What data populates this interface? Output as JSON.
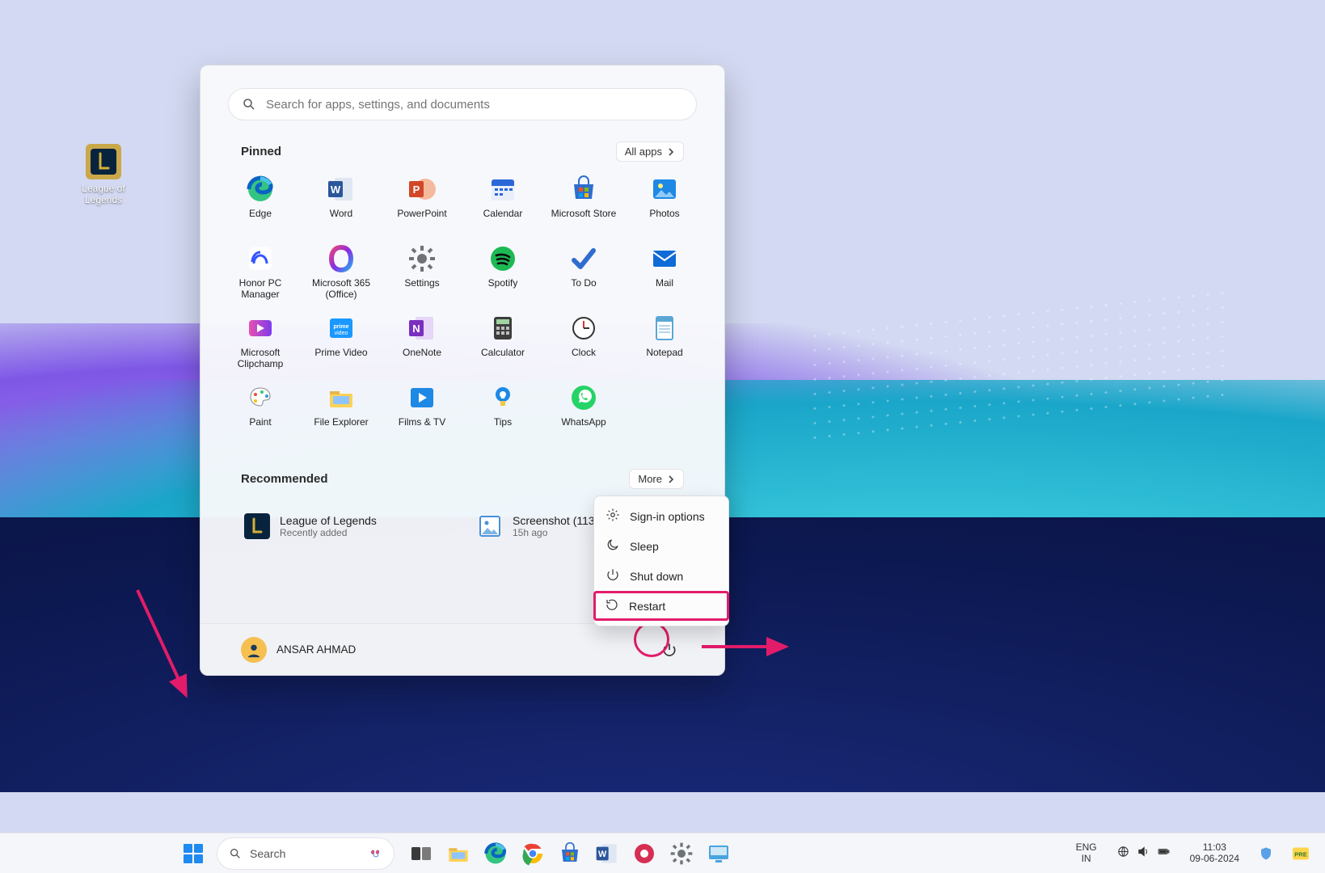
{
  "desktop": {
    "icons": [
      {
        "label": "League of Legends"
      }
    ]
  },
  "start_menu": {
    "search_placeholder": "Search for apps, settings, and documents",
    "pinned_heading": "Pinned",
    "all_apps_label": "All apps",
    "pinned": [
      {
        "label": "Edge",
        "color": "#26a5d6",
        "icon": "edge"
      },
      {
        "label": "Word",
        "color": "#2b579a",
        "icon": "word"
      },
      {
        "label": "PowerPoint",
        "color": "#d24726",
        "icon": "powerpoint"
      },
      {
        "label": "Calendar",
        "color": "#2b67d6",
        "icon": "calendar"
      },
      {
        "label": "Microsoft Store",
        "color": "#2f6dd0",
        "icon": "store"
      },
      {
        "label": "Photos",
        "color": "#1e88e5",
        "icon": "photos"
      },
      {
        "label": "Honor PC Manager",
        "color": "#3455ff",
        "icon": "honorpc"
      },
      {
        "label": "Microsoft 365 (Office)",
        "color": "#8a2be2",
        "icon": "m365"
      },
      {
        "label": "Settings",
        "color": "#6f7276",
        "icon": "settings"
      },
      {
        "label": "Spotify",
        "color": "#1db954",
        "icon": "spotify"
      },
      {
        "label": "To Do",
        "color": "#2f6dd0",
        "icon": "todo"
      },
      {
        "label": "Mail",
        "color": "#0f6bd7",
        "icon": "mail"
      },
      {
        "label": "Microsoft Clipchamp",
        "color": "#9650ff",
        "icon": "clipchamp"
      },
      {
        "label": "Prime Video",
        "color": "#2aa4d4",
        "icon": "prime"
      },
      {
        "label": "OneNote",
        "color": "#7a2fbf",
        "icon": "onenote"
      },
      {
        "label": "Calculator",
        "color": "#4d4d4d",
        "icon": "calc"
      },
      {
        "label": "Clock",
        "color": "#f4f4f4",
        "icon": "clock"
      },
      {
        "label": "Notepad",
        "color": "#2aa4d4",
        "icon": "notepad"
      },
      {
        "label": "Paint",
        "color": "#fefefe",
        "icon": "paint"
      },
      {
        "label": "File Explorer",
        "color": "#ffd257",
        "icon": "explorer"
      },
      {
        "label": "Films & TV",
        "color": "#1e88e5",
        "icon": "films"
      },
      {
        "label": "Tips",
        "color": "#1e88e5",
        "icon": "tips"
      },
      {
        "label": "WhatsApp",
        "color": "#25d366",
        "icon": "whatsapp"
      }
    ],
    "recommended_heading": "Recommended",
    "more_label": "More",
    "recommended": [
      {
        "title": "League of Legends",
        "sub": "Recently added",
        "icon": "lol"
      },
      {
        "title": "Screenshot (113",
        "sub": "15h ago",
        "icon": "image"
      }
    ],
    "user_name": "ANSAR AHMAD",
    "power_menu": [
      {
        "label": "Sign-in options",
        "icon": "gear"
      },
      {
        "label": "Sleep",
        "icon": "moon"
      },
      {
        "label": "Shut down",
        "icon": "power"
      },
      {
        "label": "Restart",
        "icon": "restart",
        "highlight": true
      }
    ]
  },
  "taskbar": {
    "search_label": "Search",
    "apps": [
      {
        "name": "task-view",
        "icon": "taskview"
      },
      {
        "name": "file-explorer",
        "icon": "explorer"
      },
      {
        "name": "edge",
        "icon": "edge"
      },
      {
        "name": "chrome",
        "icon": "chrome"
      },
      {
        "name": "microsoft-store",
        "icon": "store"
      },
      {
        "name": "word",
        "icon": "word"
      },
      {
        "name": "screen-recorder",
        "icon": "rec"
      },
      {
        "name": "settings",
        "icon": "settings"
      },
      {
        "name": "system",
        "icon": "sysinfo"
      }
    ],
    "tray": {
      "lang_top": "ENG",
      "lang_bottom": "IN",
      "time": "11:03",
      "date": "09-06-2024"
    }
  }
}
